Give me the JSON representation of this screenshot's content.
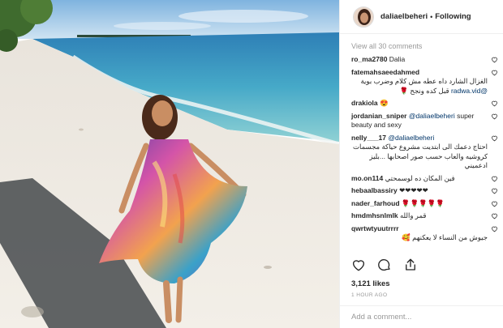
{
  "header": {
    "username": "daliaelbeheri",
    "separator": "•",
    "follow_status": "Following"
  },
  "comments": {
    "view_all": "View all 30 comments",
    "items": [
      {
        "user": "ro_ma2780",
        "text": "Dalia",
        "rtl": false
      },
      {
        "user": "fatemahsaeedahmed",
        "text": "الغزال الشارد داه عطه مش كلام وضرب بوية",
        "mention": "@radwa.vid",
        "text2": "قبل كده ونجح 🌹",
        "rtl": true
      },
      {
        "user": "drakiola",
        "text": "😍",
        "rtl": false
      },
      {
        "user": "jordanian_sniper",
        "mention": "@daliaelbeheri",
        "text": "super beauty and sexy",
        "rtl": false
      },
      {
        "user": "nelly___17",
        "mention": "@daliaelbeheri",
        "text": "احتاج دعمك الى ابتديت مشروع حياكة مجسمات كروشيه والعاب حسب صور اصحابها ...بليز ادعميني",
        "rtl": true
      },
      {
        "user": "mo.on114",
        "text": "فين المكان ده لوسمحتي",
        "rtl": false
      },
      {
        "user": "hebaalbassiry",
        "text": "❤❤❤❤❤",
        "rtl": false
      },
      {
        "user": "nader_farhoud",
        "text": "🌹🌹🌹🌹🌹",
        "rtl": false
      },
      {
        "user": "hmdmhsnlmlk",
        "text": "قمر والله",
        "rtl": false
      },
      {
        "user": "qwrtwtyuutrrrr",
        "text": "جيوش من النساء لا يعكنهم 🥰",
        "rtl": true
      }
    ]
  },
  "actions": {
    "like_icon": "heart-icon",
    "comment_icon": "comment-icon",
    "share_icon": "share-icon"
  },
  "likes": "3,121 likes",
  "time": "1 HOUR AGO",
  "add_comment": {
    "placeholder": "Add a comment..."
  },
  "colors": {
    "sea": "#3d9cc1",
    "sand": "#ece7df",
    "sky": "#9dc6e6",
    "text": "#262626",
    "muted": "#999999",
    "mention": "#003569"
  }
}
